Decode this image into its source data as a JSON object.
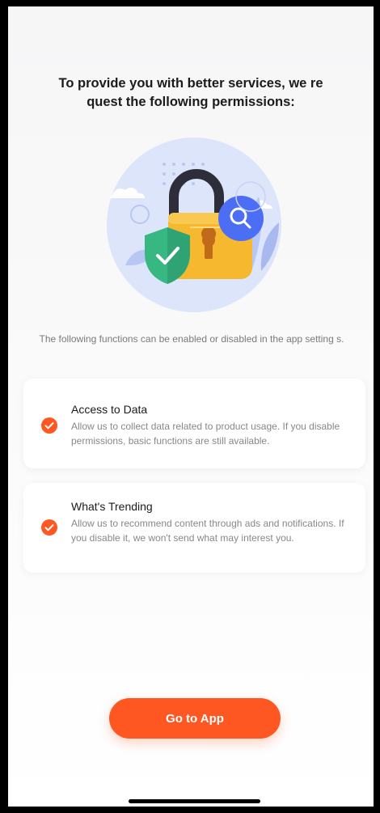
{
  "header": {
    "title": "To provide you with better services, we re quest the following permissions:"
  },
  "hint": "The following functions can be enabled or disabled in the app setting s.",
  "permissions": [
    {
      "title": "Access to Data",
      "description": "Allow us to collect data related to product usage. If you disable permissions, basic functions are still available.",
      "checked": true
    },
    {
      "title": "What's Trending",
      "description": "Allow us to recommend content through ads and notifications. If you disable it, we won't send what may interest you.",
      "checked": true
    }
  ],
  "cta": {
    "label": "Go to App"
  },
  "colors": {
    "accent": "#ff5722",
    "lock_body": "#f5b82e",
    "lock_shackle": "#2e2e3a",
    "shield": "#37b883",
    "search_badge": "#4c6ef5",
    "illustration_bg": "#dde5fb"
  },
  "icons": {
    "illustration": "padlock-shield-search-illustration",
    "check": "checkmark-icon"
  }
}
